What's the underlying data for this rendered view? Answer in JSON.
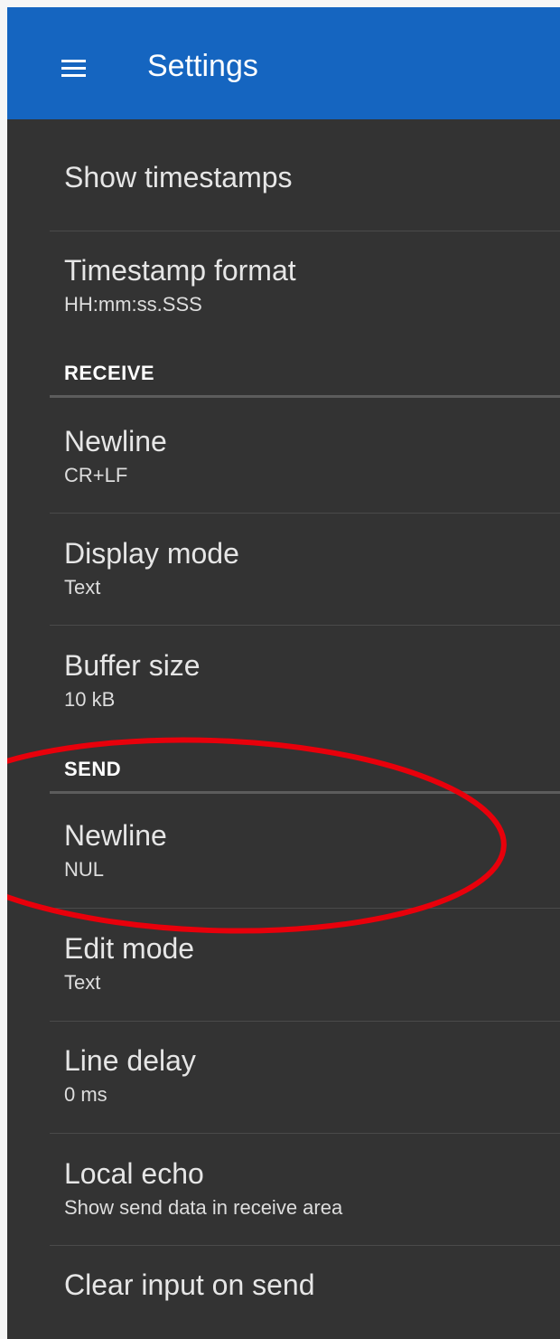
{
  "appbar": {
    "title": "Settings",
    "menu_icon": "hamburger-menu-icon",
    "color": "#1565c0"
  },
  "colors": {
    "background": "#333333",
    "annotation": "#e8000b"
  },
  "settings": {
    "show_timestamps": {
      "title": "Show timestamps"
    },
    "timestamp_format": {
      "title": "Timestamp format",
      "summary": "HH:mm:ss.SSS"
    },
    "receive": {
      "header": "RECEIVE",
      "newline": {
        "title": "Newline",
        "summary": "CR+LF"
      },
      "display_mode": {
        "title": "Display mode",
        "summary": "Text"
      },
      "buffer_size": {
        "title": "Buffer size",
        "summary": "10 kB"
      }
    },
    "send": {
      "header": "SEND",
      "newline": {
        "title": "Newline",
        "summary": "NUL"
      },
      "edit_mode": {
        "title": "Edit mode",
        "summary": "Text"
      },
      "line_delay": {
        "title": "Line delay",
        "summary": "0 ms"
      },
      "local_echo": {
        "title": "Local echo",
        "summary": "Show send data in receive area"
      },
      "clear_input": {
        "title": "Clear input on send"
      }
    }
  }
}
